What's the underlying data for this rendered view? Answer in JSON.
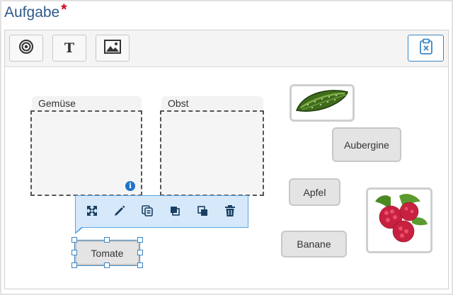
{
  "heading": {
    "title": "Aufgabe",
    "required_marker": "*"
  },
  "toolbar": {
    "buttons": [
      {
        "icon": "target-icon"
      },
      {
        "icon": "text-icon",
        "glyph": "T"
      },
      {
        "icon": "image-icon"
      }
    ],
    "right_button_icon": "clipboard-close-icon"
  },
  "zones": [
    {
      "label": "Gemüse"
    },
    {
      "label": "Obst"
    }
  ],
  "info_icon": {
    "glyph": "i"
  },
  "items": {
    "aubergine": "Aubergine",
    "apfel": "Apfel",
    "banane": "Banane",
    "tomate": "Tomate"
  },
  "images": {
    "cucumber": "cucumber-image",
    "raspberry": "raspberry-image"
  },
  "context_toolbar": {
    "actions": [
      "move",
      "edit",
      "duplicate",
      "bring-to-front",
      "send-to-back",
      "delete"
    ]
  },
  "colors": {
    "heading": "#2e5a8a",
    "required": "#d0021b",
    "accent": "#3c86c4",
    "context_bg": "#d6e9fb"
  }
}
